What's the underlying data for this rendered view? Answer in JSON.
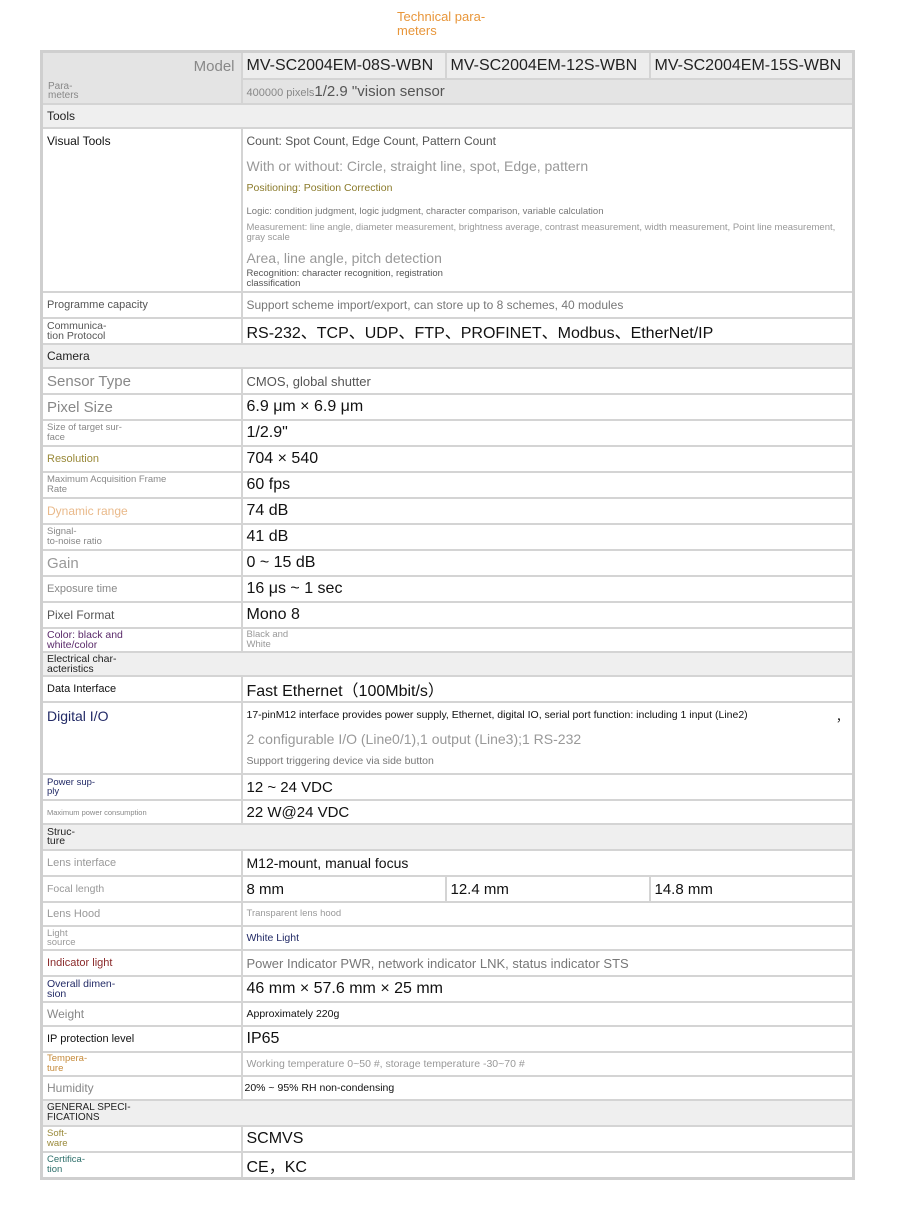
{
  "title": "Technical para-\nmeters",
  "header": {
    "corner_model": "Model",
    "corner_params": "Para-\nmeters",
    "models": [
      "MV-SC2004EM-08S-WBN",
      "MV-SC2004EM-12S-WBN",
      "MV-SC2004EM-15S-WBN"
    ],
    "pixels_small": "400000 pixels",
    "pixels_large": "1/2.9 \"vision sensor"
  },
  "tools": {
    "section": "Tools",
    "visual_label": "Visual Tools",
    "visual_lines": [
      "Count: Spot Count, Edge Count, Pattern Count",
      "With or without: Circle, straight line, spot, Edge, pattern",
      "Positioning: Position Correction",
      "Logic: condition judgment, logic judgment, character comparison, variable calculation",
      "Measurement: line angle, diameter measurement, brightness average, contrast measurement, width measurement, Point line measurement, gray scale",
      "Area, line angle, pitch detection",
      "Recognition: character recognition, registration\nclassification"
    ],
    "capacity_label": "Programme capacity",
    "capacity_value": "Support scheme import/export, can store up to 8 schemes, 40 modules",
    "protocol_label": "Communica-\ntion Protocol",
    "protocol_value": "RS-232、TCP、UDP、FTP、PROFINET、Modbus、EtherNet/IP"
  },
  "camera": {
    "section": "Camera",
    "sensor_label": "Sensor Type",
    "sensor_value": "CMOS, global shutter",
    "pixel_label": "Pixel Size",
    "pixel_value": "6.9 μm × 6.9 μm",
    "target_label": "Size of target sur-\nface",
    "target_value": "1/2.9\"",
    "resolution_label": "Resolution",
    "resolution_value": "704 × 540",
    "frame_label": "Maximum Acquisition Frame\nRate",
    "frame_value": "60 fps",
    "dynamic_label": "Dynamic range",
    "dynamic_value": "74 dB",
    "snr_label": "Signal-\nto-noise ratio",
    "snr_value": "41 dB",
    "gain_label": "Gain",
    "gain_value": "0 ~ 15 dB",
    "exposure_label": "Exposure time",
    "exposure_value": "16 μs ~ 1 sec",
    "format_label": "Pixel Format",
    "format_value": "Mono 8",
    "color_label": "Color: black and\nwhite/color",
    "color_value": "Black and\nWhite"
  },
  "electrical": {
    "section": "Electrical char-\nacteristics",
    "data_label": "Data Interface",
    "data_value": "Fast Ethernet（100Mbit/s）",
    "io_label": "Digital I/O",
    "io_line1": "17-pinM12 interface provides power supply, Ethernet, digital IO, serial port function: including 1 input (Line2)",
    "io_comma": "，",
    "io_line2": "2 configurable I/O (Line0/1),1 output (Line3);1 RS-232",
    "io_line3": "Support triggering device via side button",
    "power_label": "Power sup-\nply",
    "power_value": "12 ~ 24 VDC",
    "consumption_label": "Maximum power consumption",
    "consumption_value": "22 W@24 VDC"
  },
  "structure": {
    "section": "Struc-\nture",
    "lens_label": "Lens interface",
    "lens_value": "M12-mount, manual focus",
    "focal_label": "Focal length",
    "focal_values": [
      "8 mm",
      "12.4 mm",
      "14.8 mm"
    ],
    "hood_label": "Lens Hood",
    "hood_value": "Transparent lens hood",
    "light_label": "Light\nsource",
    "light_value": "White Light",
    "indicator_label": "Indicator light",
    "indicator_value": "Power Indicator PWR, network indicator LNK, status indicator STS",
    "dimension_label": "Overall dimen-\nsion",
    "dimension_value": "46 mm × 57.6 mm × 25 mm",
    "weight_label": "Weight",
    "weight_value": "Approximately 220g",
    "ip_label": "IP protection level",
    "ip_value": "IP65",
    "temp_label": "Tempera-\nture",
    "temp_value": "Working temperature 0~50 #, storage temperature -30~70 #",
    "humidity_label": "Humidity",
    "humidity_value": "20% ~ 95% RH non-condensing"
  },
  "general": {
    "section": "GENERAL SPECI-\nFICATIONS",
    "software_label": "Soft-\nware",
    "software_value": "SCMVS",
    "cert_label": "Certifica-\ntion",
    "cert_value": "CE，KC"
  }
}
